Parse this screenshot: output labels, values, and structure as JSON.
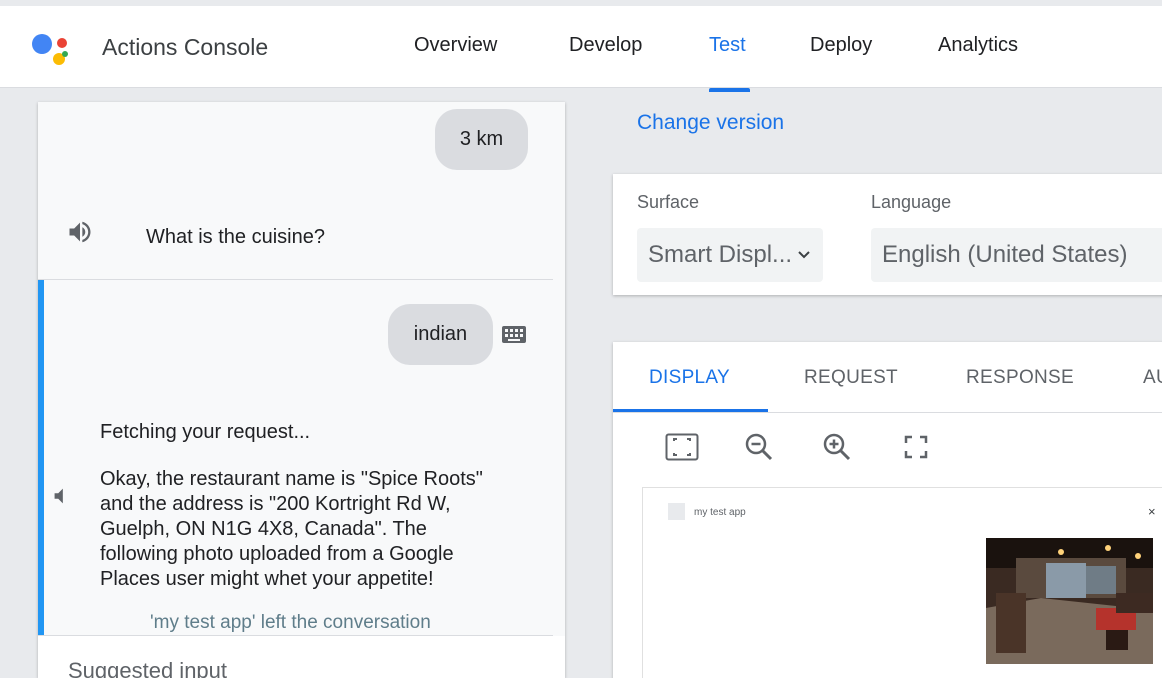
{
  "header": {
    "app_title": "Actions Console",
    "nav": [
      "Overview",
      "Develop",
      "Test",
      "Deploy",
      "Analytics"
    ],
    "active_nav": "Test"
  },
  "chat": {
    "user_message_1": "3 km",
    "assistant_question": "What is the cuisine?",
    "user_message_2": "indian",
    "assistant_status": "Fetching your request...",
    "assistant_response": "Okay, the restaurant name is \"Spice Roots\" and the address is \"200 Kortright Rd W, Guelph, ON N1G 4X8, Canada\". The following photo uploaded from a Google Places user might whet your appetite!",
    "left_conversation_note": "'my test app' left the conversation",
    "suggested_input_label": "Suggested input"
  },
  "settings": {
    "change_version": "Change version",
    "surface_label": "Surface",
    "surface_value": "Smart Displ...",
    "language_label": "Language",
    "language_value": "English (United States)"
  },
  "tabs": [
    "DISPLAY",
    "REQUEST",
    "RESPONSE",
    "AU"
  ],
  "active_tab": "DISPLAY",
  "display_tools": [
    "fit-screen-icon",
    "zoom-out-icon",
    "zoom-in-icon",
    "fullscreen-icon"
  ],
  "device": {
    "app_name": "my test app",
    "close_glyph": "×"
  },
  "colors": {
    "accent": "#1a73e8",
    "active_bar": "#2196f3",
    "bubble": "#dadce0",
    "background": "#e8eaed"
  }
}
